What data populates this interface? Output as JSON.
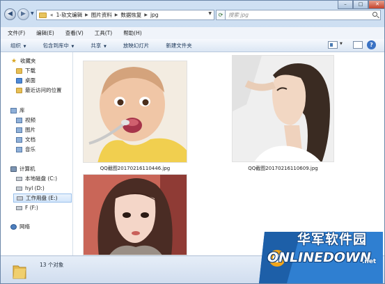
{
  "breadcrumb": [
    "«",
    "1-软文编辑",
    "图片资料",
    "数据恢复",
    "jpg"
  ],
  "search": {
    "placeholder": "搜索 jpg"
  },
  "menu": [
    "文件(F)",
    "编辑(E)",
    "查看(V)",
    "工具(T)",
    "帮助(H)"
  ],
  "commands": [
    {
      "label": "组织",
      "dropdown": true
    },
    {
      "label": "包含到库中",
      "dropdown": true
    },
    {
      "label": "共享",
      "dropdown": true
    },
    {
      "label": "放映幻灯片",
      "dropdown": false
    },
    {
      "label": "新建文件夹",
      "dropdown": false
    }
  ],
  "nav": {
    "favorites": {
      "label": "收藏夹",
      "items": [
        "下载",
        "桌面",
        "最近访问的位置"
      ]
    },
    "libraries": {
      "label": "库",
      "items": [
        "视频",
        "图片",
        "文档",
        "音乐"
      ]
    },
    "computer": {
      "label": "计算机",
      "items": [
        "本地磁盘 (C:)",
        "hyl (D:)",
        "工作用盘 (E:)",
        "F (F:)"
      ],
      "selected": "工作用盘 (E:)"
    },
    "network": {
      "label": "网络"
    }
  },
  "files": [
    {
      "name": "QQ截图20170216110446.jpg"
    },
    {
      "name": "QQ截图20170216110609.jpg"
    },
    {
      "name": ""
    }
  ],
  "status": {
    "text": "13 个对象"
  },
  "watermark": {
    "title": "华军软件园",
    "sub": "ONLINEDOWN",
    "tld": ".net"
  },
  "colors": {
    "accent": "#3a72c4",
    "selection": "#d3e6fb"
  }
}
